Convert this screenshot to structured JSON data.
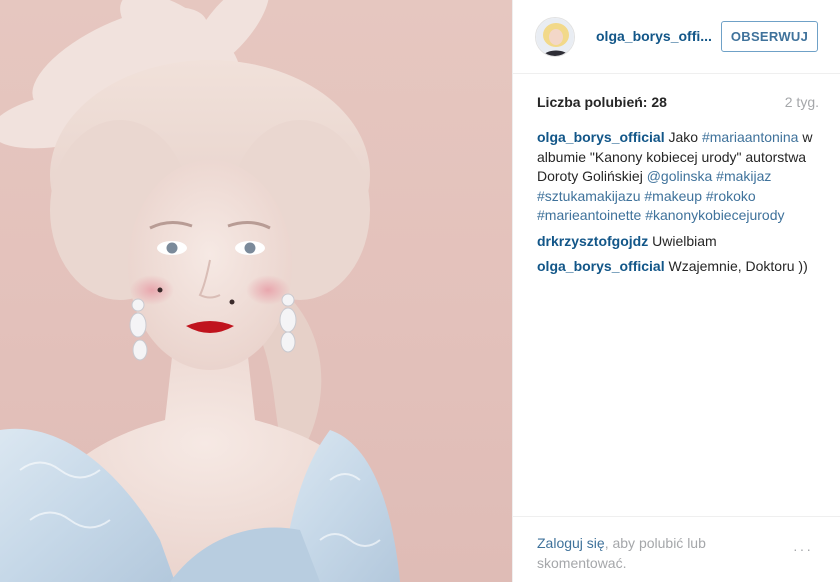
{
  "post": {
    "image_alt": "Portrait of a woman styled as Marie Antoinette with powdered wig and feathers"
  },
  "header": {
    "username": "olga_borys_offi...",
    "follow_label": "OBSERWUJ"
  },
  "stats": {
    "likes_label": "Liczba polubień: 28",
    "time_ago": "2 tyg."
  },
  "comments": [
    {
      "user": "olga_borys_official",
      "parts": [
        {
          "t": "text",
          "v": " Jako "
        },
        {
          "t": "tag",
          "v": "#mariaantonina"
        },
        {
          "t": "text",
          "v": " w albumie \"Kanony kobiecej urody\" autorstwa Doroty Golińskiej "
        },
        {
          "t": "tag",
          "v": "@golinska"
        },
        {
          "t": "text",
          "v": " "
        },
        {
          "t": "tag",
          "v": "#makijaz"
        },
        {
          "t": "text",
          "v": " "
        },
        {
          "t": "tag",
          "v": "#sztukamakijazu"
        },
        {
          "t": "text",
          "v": " "
        },
        {
          "t": "tag",
          "v": "#makeup"
        },
        {
          "t": "text",
          "v": " "
        },
        {
          "t": "tag",
          "v": "#rokoko"
        },
        {
          "t": "text",
          "v": " "
        },
        {
          "t": "tag",
          "v": "#marieantoinette"
        },
        {
          "t": "text",
          "v": " "
        },
        {
          "t": "tag",
          "v": "#kanonykobiecejurody"
        }
      ]
    },
    {
      "user": "drkrzysztofgojdz",
      "parts": [
        {
          "t": "text",
          "v": " Uwielbiam"
        }
      ]
    },
    {
      "user": "olga_borys_official",
      "parts": [
        {
          "t": "text",
          "v": " Wzajemnie, Doktoru ))"
        }
      ]
    }
  ],
  "footer": {
    "login_link": "Zaloguj się",
    "login_rest": ", aby polubić lub skomentować.",
    "more_label": "···"
  },
  "colors": {
    "link": "#125688",
    "tag": "#3f729b",
    "muted": "#a5a7aa",
    "border": "#efefef"
  },
  "icons": {
    "avatar": "profile-photo",
    "more": "more-options-icon"
  }
}
